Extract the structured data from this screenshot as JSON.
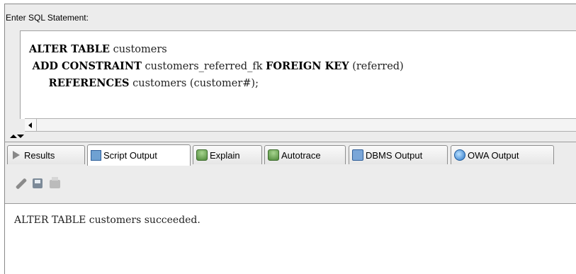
{
  "sql_editor": {
    "label": "Enter SQL Statement:",
    "lines": [
      {
        "kw1": "ALTER TABLE",
        "t1": " customers",
        "kw2": "",
        "t2": "",
        "kw3": "",
        "t3": ""
      },
      {
        "kw1": "ADD CONSTRAINT",
        "t1": " customers_referred_fk ",
        "kw2": "FOREIGN KEY",
        "t2": " (referred)",
        "kw3": "",
        "t3": ""
      },
      {
        "kw1": "REFERENCES",
        "t1": " customers (customer#);",
        "kw2": "",
        "t2": "",
        "kw3": "",
        "t3": ""
      }
    ]
  },
  "tabs": [
    {
      "label": "Results",
      "icon": "play-icon"
    },
    {
      "label": "Script Output",
      "icon": "script-icon"
    },
    {
      "label": "Explain",
      "icon": "explain-icon"
    },
    {
      "label": "Autotrace",
      "icon": "autotrace-icon"
    },
    {
      "label": "DBMS Output",
      "icon": "dbms-icon"
    },
    {
      "label": "OWA Output",
      "icon": "owa-icon"
    }
  ],
  "active_tab": "Script Output",
  "toolbar": {
    "icons": [
      "pencil-icon",
      "save-icon",
      "print-icon"
    ]
  },
  "output": {
    "text": "ALTER TABLE customers succeeded."
  }
}
